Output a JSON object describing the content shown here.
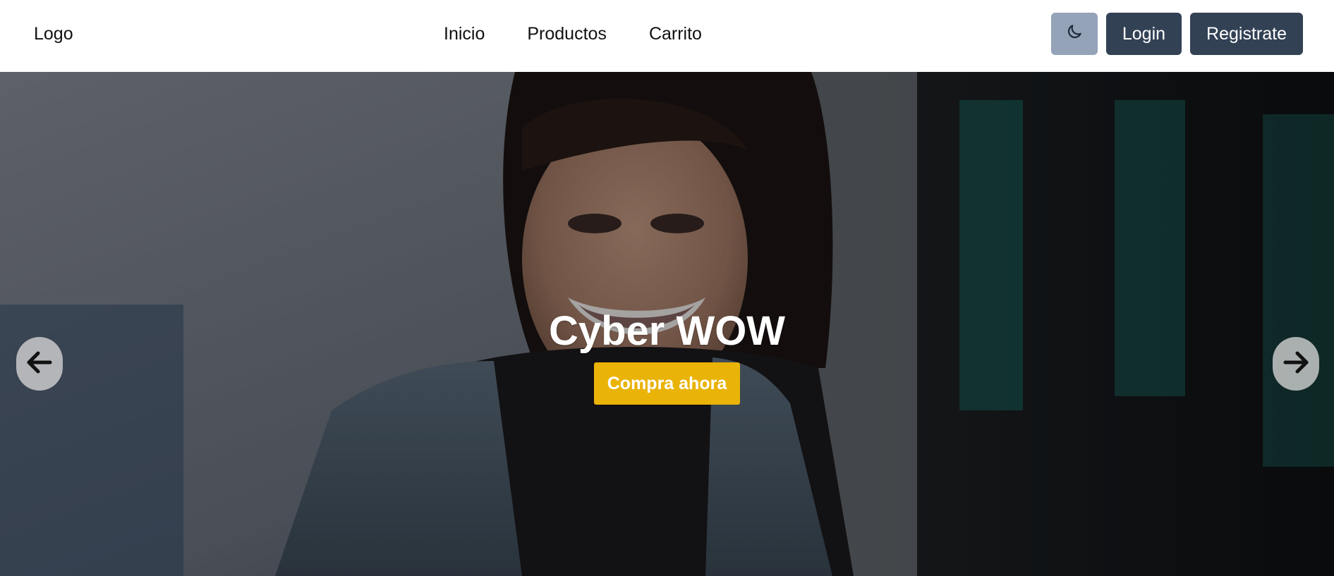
{
  "header": {
    "logo": "Logo",
    "nav": [
      "Inicio",
      "Productos",
      "Carrito"
    ],
    "theme_icon": "moon-icon",
    "login_label": "Login",
    "register_label": "Registrate"
  },
  "hero": {
    "title": "Cyber WOW",
    "cta_label": "Compra ahora",
    "prev_icon": "arrow-left-icon",
    "next_icon": "arrow-right-icon"
  },
  "colors": {
    "accent": "#eab308",
    "button_dark": "#334155",
    "button_light": "#94a3b8"
  }
}
